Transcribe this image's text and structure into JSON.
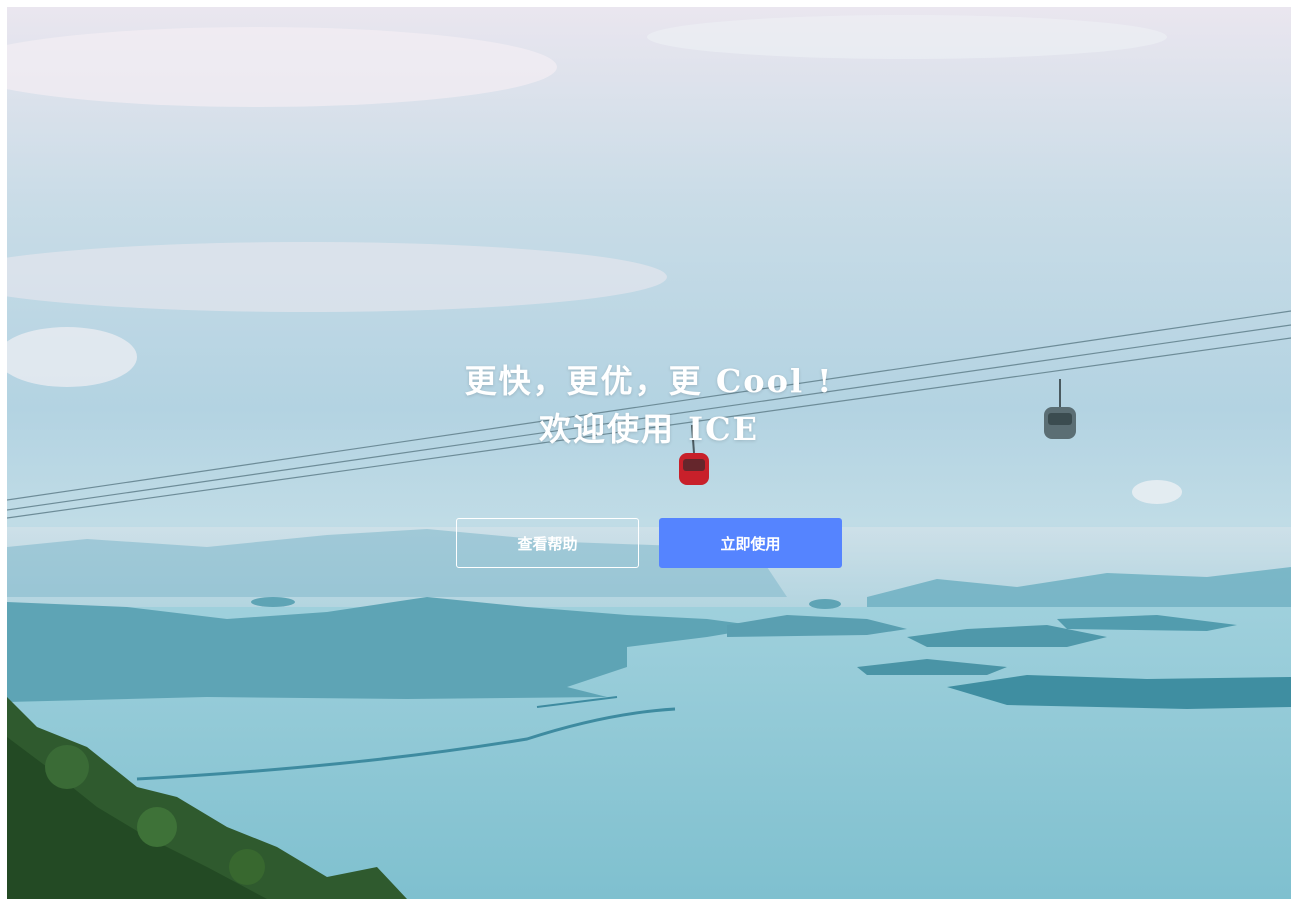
{
  "hero": {
    "title_line_1": "更快，更优，更 Cool !",
    "title_line_2": "欢迎使用 ICE",
    "background_image": "cable-car-over-islands-and-sea"
  },
  "buttons": {
    "help_label": "查看帮助",
    "start_label": "立即使用"
  },
  "colors": {
    "primary_button": "#5584ff",
    "title_text": "#ffffff"
  }
}
